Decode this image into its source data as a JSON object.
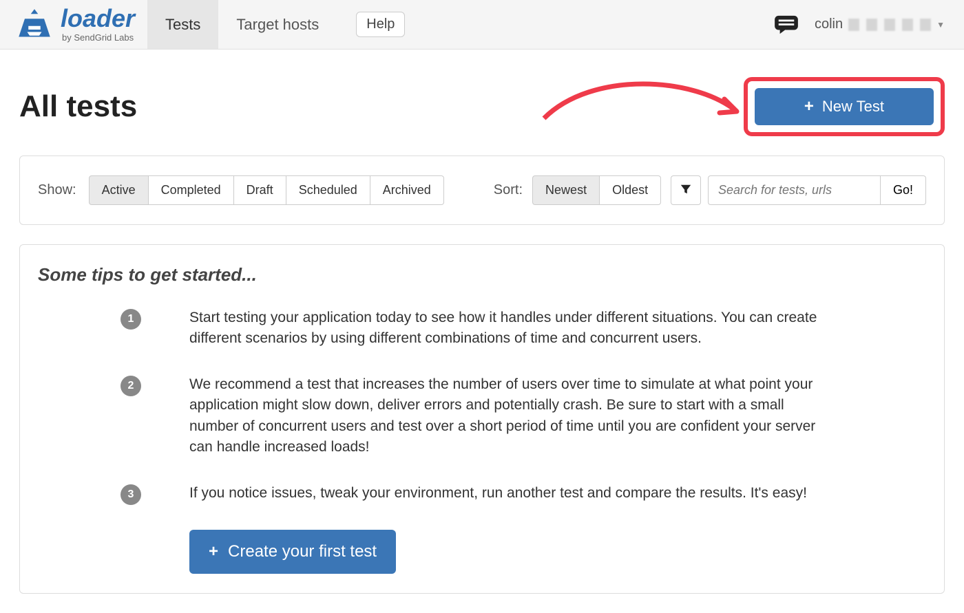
{
  "brand": {
    "name": "loader",
    "byline": "by SendGrid Labs",
    "color": "#2f6fb3"
  },
  "nav": {
    "items": [
      {
        "label": "Tests",
        "active": true
      },
      {
        "label": "Target hosts",
        "active": false
      }
    ],
    "help_label": "Help",
    "user_prefix": "colin"
  },
  "header": {
    "title": "All tests",
    "new_test_label": "New Test",
    "highlight_color": "#ef3b4a"
  },
  "filters": {
    "show_label": "Show:",
    "show_options": [
      {
        "label": "Active",
        "active": true
      },
      {
        "label": "Completed",
        "active": false
      },
      {
        "label": "Draft",
        "active": false
      },
      {
        "label": "Scheduled",
        "active": false
      },
      {
        "label": "Archived",
        "active": false
      }
    ],
    "sort_label": "Sort:",
    "sort_options": [
      {
        "label": "Newest",
        "active": true
      },
      {
        "label": "Oldest",
        "active": false
      }
    ],
    "search_placeholder": "Search for tests, urls",
    "go_label": "Go!"
  },
  "tips": {
    "title": "Some tips to get started...",
    "items": [
      {
        "n": "1",
        "text": "Start testing your application today to see how it handles under different situations. You can create different scenarios by using different combinations of time and concurrent users."
      },
      {
        "n": "2",
        "text": "We recommend a test that increases the number of users over time to simulate at what point your application might slow down, deliver errors and potentially crash. Be sure to start with a small number of concurrent users and test over a short period of time until you are confident your server can handle increased loads!"
      },
      {
        "n": "3",
        "text": "If you notice issues, tweak your environment, run another test and compare the results. It's easy!"
      }
    ],
    "cta_label": "Create your first test"
  }
}
